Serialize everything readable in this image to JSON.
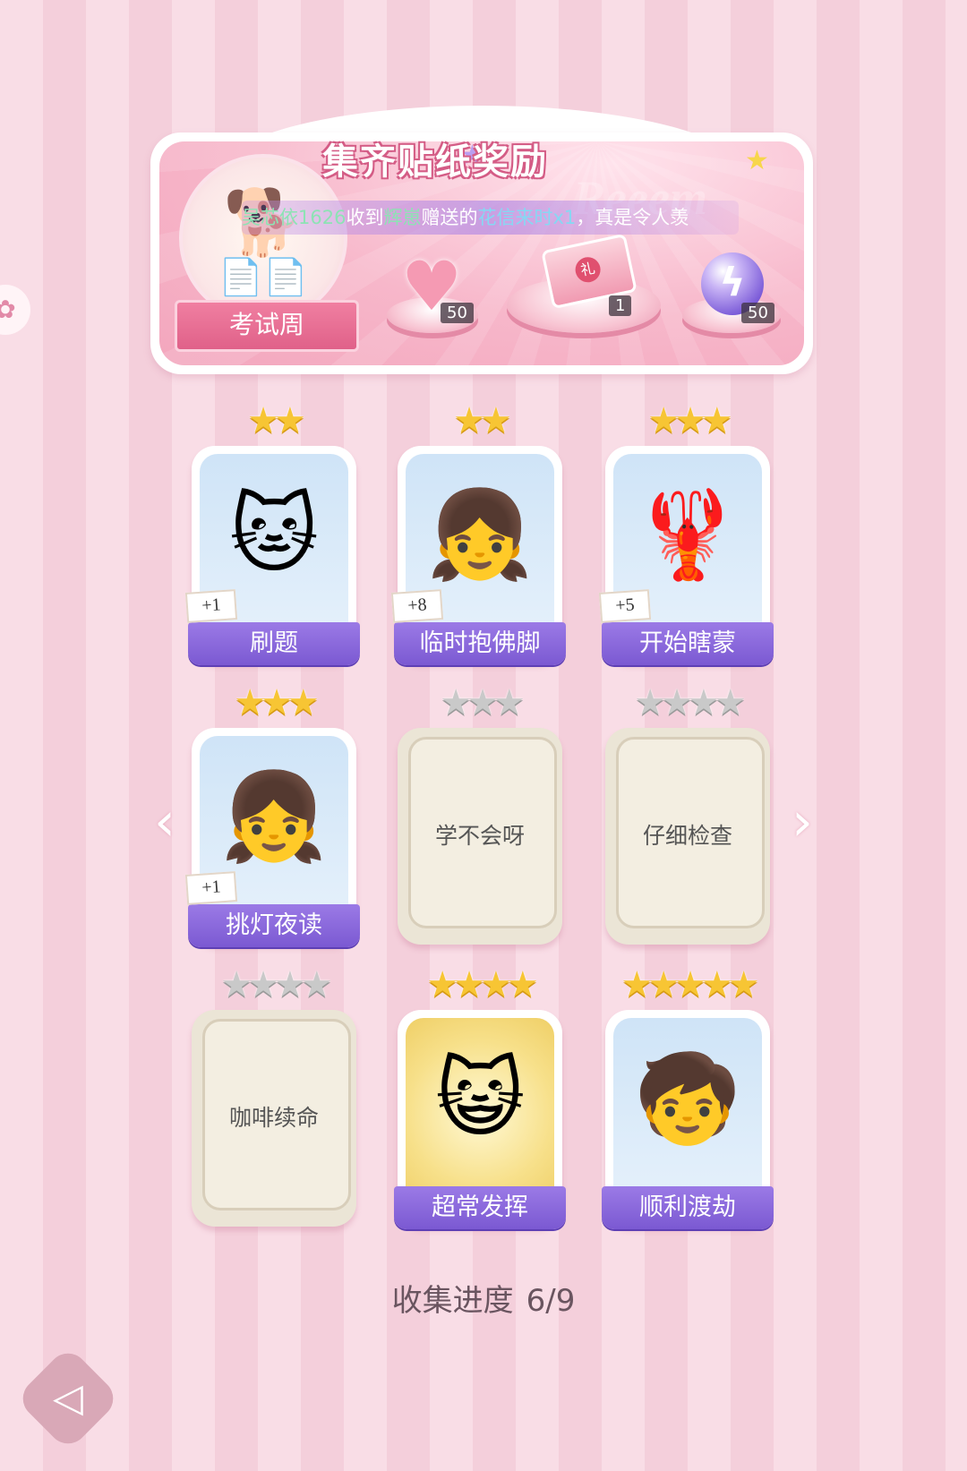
{
  "banner": {
    "title": "集齐贴纸奖励",
    "ghost_text": "Reeem",
    "marquee": {
      "user": "吴芯依1626",
      "received": "收到",
      "sender": "辉崽",
      "gave": "赠送的",
      "item": "花信来时x1",
      "tail": "，真是令人羡"
    },
    "theme_label": "考试周",
    "rewards": [
      {
        "icon": "heart-gem-icon",
        "count": "50"
      },
      {
        "icon": "gift-box-icon",
        "count": "1"
      },
      {
        "icon": "lightning-orb-icon",
        "count": "50"
      }
    ]
  },
  "cards": [
    {
      "label": "刷题",
      "stars_total": 2,
      "stars_filled": 2,
      "plus": "+1",
      "unlocked": true,
      "icon": "cat-writing-icon"
    },
    {
      "label": "临时抱佛脚",
      "stars_total": 2,
      "stars_filled": 2,
      "plus": "+8",
      "unlocked": true,
      "icon": "girl-praying-icon"
    },
    {
      "label": "开始瞎蒙",
      "stars_total": 3,
      "stars_filled": 3,
      "plus": "+5",
      "unlocked": true,
      "icon": "lobster-sign-icon"
    },
    {
      "label": "挑灯夜读",
      "stars_total": 3,
      "stars_filled": 3,
      "plus": "+1",
      "unlocked": true,
      "icon": "girl-lamp-icon"
    },
    {
      "label": "学不会呀",
      "stars_total": 3,
      "stars_filled": 0,
      "unlocked": false
    },
    {
      "label": "仔细检查",
      "stars_total": 4,
      "stars_filled": 0,
      "unlocked": false
    },
    {
      "label": "咖啡续命",
      "stars_total": 4,
      "stars_filled": 0,
      "unlocked": false
    },
    {
      "label": "超常发挥",
      "stars_total": 4,
      "stars_filled": 4,
      "unlocked": true,
      "gold": true,
      "icon": "cat-pencils-icon"
    },
    {
      "label": "顺利渡劫",
      "stars_total": 5,
      "stars_filled": 5,
      "unlocked": true,
      "icon": "girl-pen-icon"
    }
  ],
  "progress": {
    "label": "收集进度",
    "value": "6/9"
  },
  "colors": {
    "accent_purple": "#7b59d2",
    "banner_pink": "#f3a6bd",
    "star_gold": "#f7c534"
  }
}
